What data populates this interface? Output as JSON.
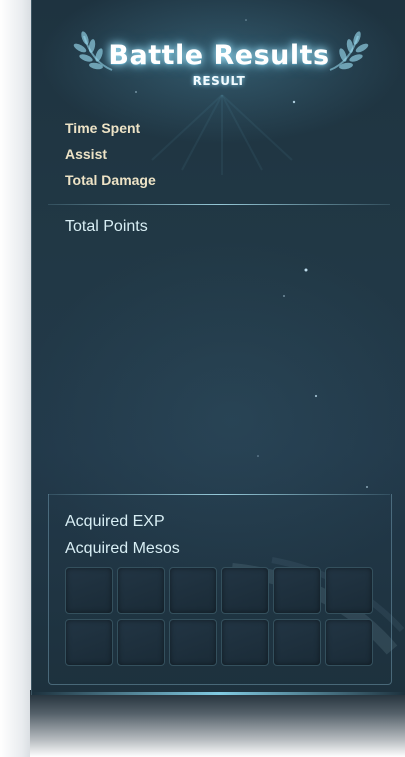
{
  "window": {
    "title": "Battle Results",
    "subtitle": "RESULT"
  },
  "stats": [
    {
      "label": "Time Spent"
    },
    {
      "label": "Assist"
    },
    {
      "label": "Total Damage"
    }
  ],
  "summary": {
    "total_points_label": "Total Points"
  },
  "rewards": {
    "exp_label": "Acquired EXP",
    "mesos_label": "Acquired Mesos",
    "slot_rows": 2,
    "slot_columns": 6
  },
  "colors": {
    "panel_background": "#213845",
    "title_glow": "#aaebff",
    "stat_text": "#ede3c6",
    "label_text": "#d8eef4"
  }
}
